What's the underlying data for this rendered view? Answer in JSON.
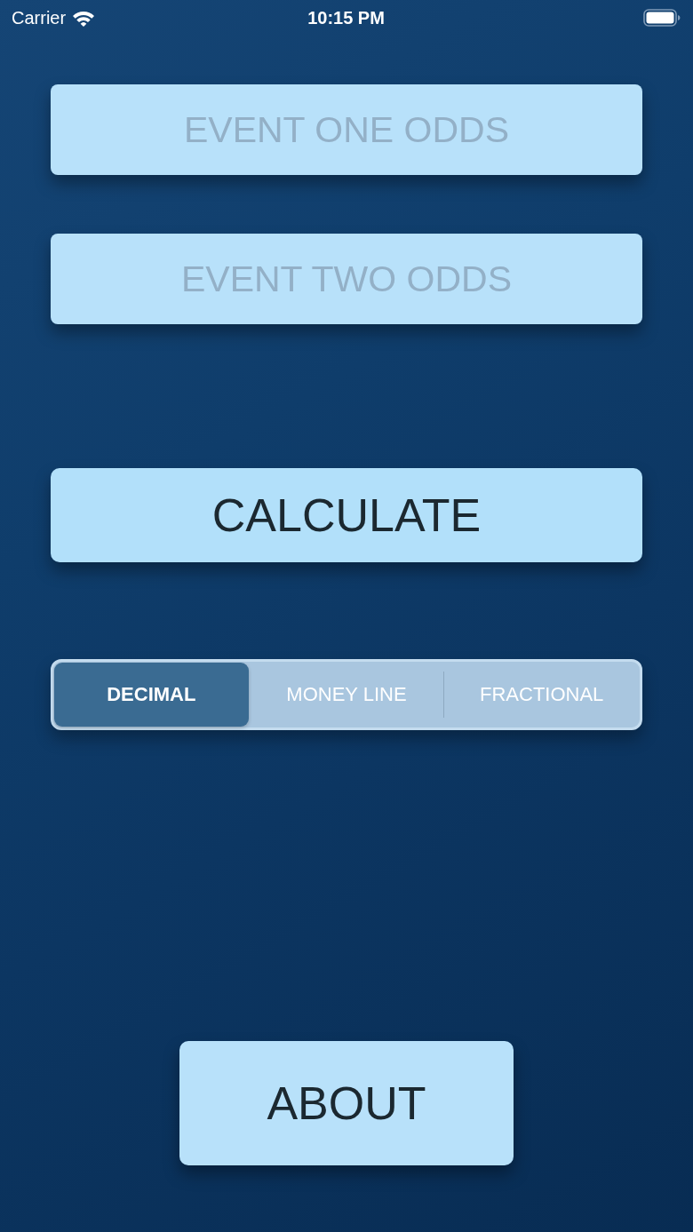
{
  "status_bar": {
    "carrier": "Carrier",
    "time": "10:15 PM"
  },
  "odds_fields": [
    {
      "placeholder": "EVENT ONE ODDS"
    },
    {
      "placeholder": "EVENT TWO ODDS"
    }
  ],
  "calculate_button": {
    "label": "CALCULATE"
  },
  "odds_format": [
    {
      "label": "DECIMAL",
      "selected": true
    },
    {
      "label": "MONEY LINE",
      "selected": false
    },
    {
      "label": "FRACTIONAL",
      "selected": false
    }
  ],
  "about_button": {
    "label": "ABOUT"
  }
}
